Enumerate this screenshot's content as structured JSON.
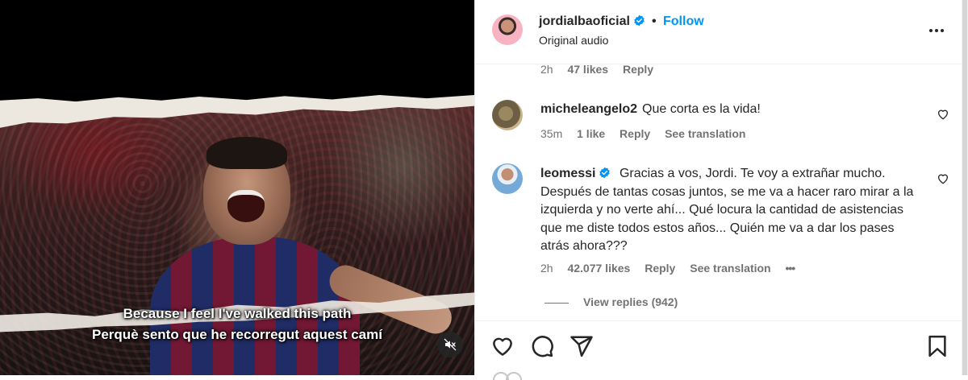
{
  "media": {
    "caption_line1": "Because I feel I've walked this path",
    "caption_line2": "Perquè sento que he recorregut aquest camí",
    "mute_icon": "speaker-muted-icon"
  },
  "header": {
    "username": "jordialbaoficial",
    "verified": true,
    "separator": "•",
    "follow_label": "Follow",
    "audio_label": "Original audio",
    "more_icon": "more-horizontal-icon"
  },
  "prev_comment_meta": {
    "time": "2h",
    "likes": "47 likes",
    "reply": "Reply"
  },
  "comments": [
    {
      "username": "micheleangelo2",
      "verified": false,
      "text": "Que corta es la vida!",
      "time": "35m",
      "likes": "1 like",
      "reply": "Reply",
      "translate": "See translation"
    },
    {
      "username": "leomessi",
      "verified": true,
      "text": "Gracias a vos, Jordi. Te voy a extrañar mucho. Después de tantas cosas juntos, se me va a hacer raro mirar a la izquierda y no verte ahí... Qué locura la cantidad de asistencias que me diste todos estos años... Quién me va a dar los pases atrás ahora???",
      "time": "2h",
      "likes": "42.077 likes",
      "reply": "Reply",
      "translate": "See translation",
      "options": "•••",
      "view_replies": "View replies (942)"
    }
  ],
  "actions": {
    "like_icon": "heart-icon",
    "comment_icon": "comment-icon",
    "share_icon": "share-icon",
    "save_icon": "bookmark-icon"
  },
  "colors": {
    "accent": "#0095f6",
    "verified": "#0095f6",
    "text": "#262626",
    "muted": "#737373",
    "divider": "#efefef"
  }
}
